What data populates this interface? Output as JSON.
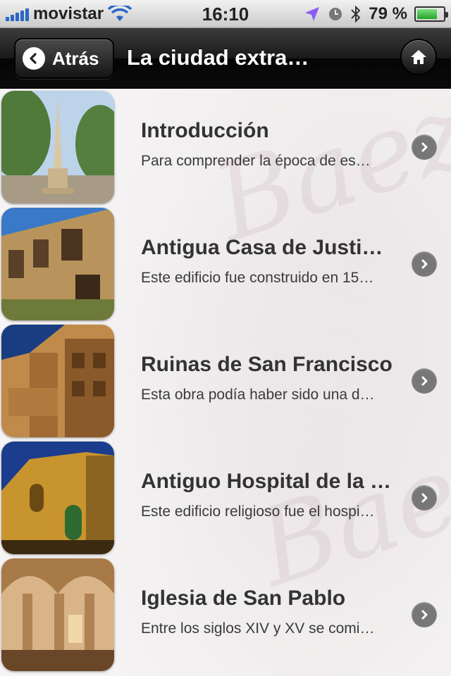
{
  "status_bar": {
    "carrier": "movistar",
    "time": "16:10",
    "battery": "79 %",
    "battery_level": 0.79
  },
  "nav": {
    "back_label": "Atrás",
    "title": "La ciudad extra…"
  },
  "items": [
    {
      "title": "Introducción",
      "subtitle": "Para comprender la época de es…"
    },
    {
      "title": "Antigua Casa de Justi…",
      "subtitle": "Este edificio fue construido en 15…"
    },
    {
      "title": "Ruinas de San Francisco",
      "subtitle": "Esta obra podía haber sido una d…"
    },
    {
      "title": "Antiguo Hospital de la …",
      "subtitle": "Este edificio religioso fue el hospi…"
    },
    {
      "title": "Iglesia de San Pablo",
      "subtitle": "Entre los siglos XIV y XV se comi…"
    }
  ],
  "colors": {
    "nav_bg": "#111111",
    "title_text": "#333333",
    "chevron": "#777777",
    "signal": "#2a67c6",
    "location_arrow": "#8b5cf6"
  }
}
